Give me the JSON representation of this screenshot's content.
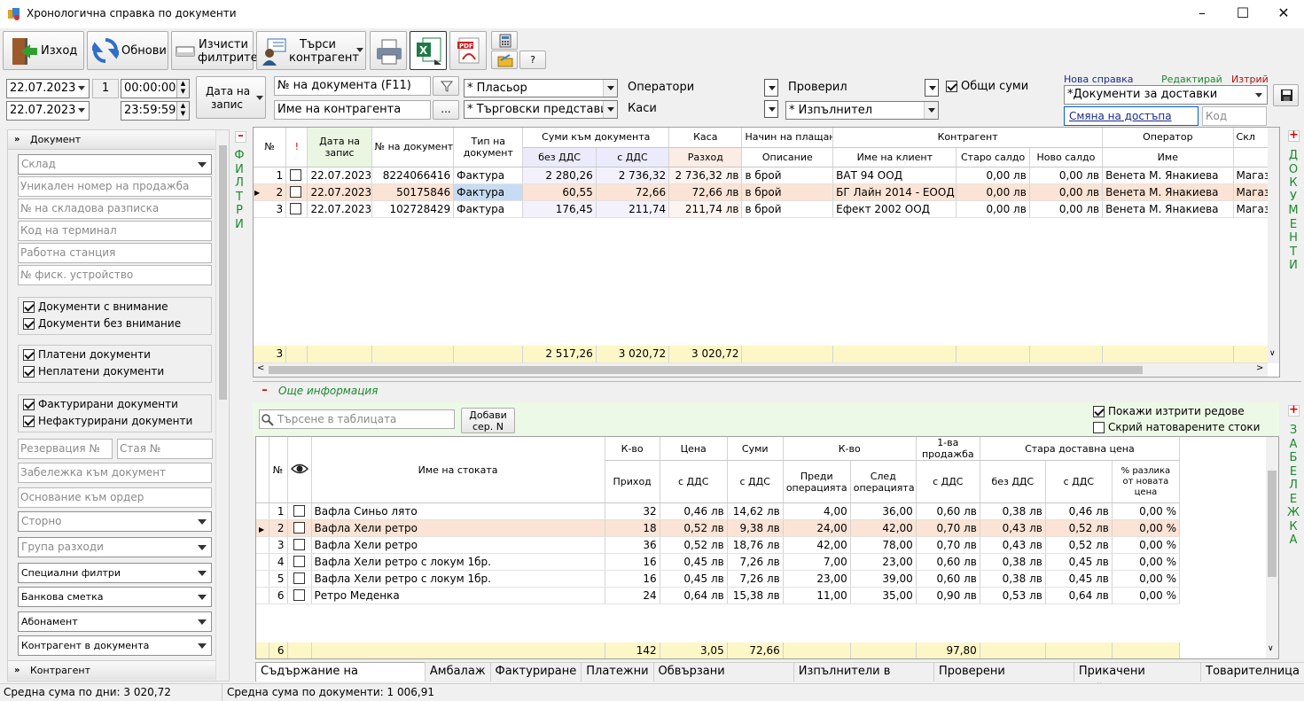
{
  "window": {
    "title": "Хронологична справка по документи"
  },
  "toolbar": {
    "exit": "Изход",
    "refresh": "Обнови",
    "clear_line1": "Изчисти",
    "clear_line2": "филтрите",
    "search_line1": "Търси",
    "search_line2": "контрагент",
    "help": "?"
  },
  "filters": {
    "date_from": "22.07.2023",
    "date_to": "22.07.2023",
    "day_count": "1",
    "time_from": "00:00:00",
    "time_to": "23:59:59",
    "date_mode_line1": "Дата на",
    "date_mode_line2": "запис",
    "doc_number_placeholder": "№ на документа (F11)",
    "counterparty_placeholder": "Име на контрагента",
    "more_button": "...",
    "placer": "* Пласьор",
    "sales_reps": "* Търговски представител",
    "operators": "Оператори",
    "cashboxes": "Каси",
    "checked_by": "Проверил",
    "executor": "* Изпълнител",
    "totals_label": "Общи суми"
  },
  "report": {
    "new": "Нова справка",
    "edit": "Редактирай",
    "delete": "Изтрий",
    "selected": "*Документи за доставки",
    "change_access": "Смяна на достъпа",
    "code_placeholder": "Код"
  },
  "sidebar": {
    "section_document": "Документ",
    "warehouse": "Склад",
    "unique_sale_no": "Уникален номер на продажба",
    "warehouse_receipt_no": "№ на складова разписка",
    "terminal_code": "Код на терминал",
    "workstation": "Работна станция",
    "fiscal_device_no": "№ фиск. устройство",
    "chk_attention": "Документи с внимание",
    "chk_no_attention": "Документи без внимание",
    "chk_paid": "Платени документи",
    "chk_unpaid": "Неплатени документи",
    "chk_invoiced": "Фактурирани документи",
    "chk_not_invoiced": "Нефактурирани документи",
    "reservation_no": "Резервация №",
    "room_no": "Стая №",
    "doc_note": "Забележка към документ",
    "order_basis": "Основание към ордер",
    "storno": "Сторно",
    "expense_group": "Група разходи",
    "special_filters": "Специални филтри",
    "bank_account": "Банкова сметка",
    "subscription": "Абонамент",
    "doc_counterparty": "Контрагент в документа",
    "section_counterparty": "Контрагент",
    "filters_vertical": "ФИЛТРИ"
  },
  "docs": {
    "headers": {
      "no": "№",
      "attn": "!",
      "date_line1": "Дата на",
      "date_line2": "запис",
      "doc_no": "№ на документ",
      "type_line1": "Тип на",
      "type_line2": "документ",
      "sums": "Суми към документа",
      "no_vat": "без ДДС",
      "with_vat": "с ДДС",
      "cash": "Каса",
      "expense": "Разход",
      "payment": "Начин на плащане",
      "description": "Описание",
      "counterparty": "Контрагент",
      "client_name": "Име на клиент",
      "old_balance": "Старо салдо",
      "new_balance": "Ново салдо",
      "operator": "Оператор",
      "op_name": "Име",
      "store": "Скл"
    },
    "rows": [
      {
        "n": "1",
        "date": "22.07.2023",
        "doc": "8224066416",
        "type": "Фактура",
        "nov": "2 280,26",
        "wv": "2 736,32",
        "exp": "2 736,32 лв",
        "pay": "в брой",
        "client": "ВАТ 94 ООД",
        "old": "0,00 лв",
        "new": "0,00 лв",
        "op": "Венета М. Янакиева",
        "store": "Магазин Е"
      },
      {
        "n": "2",
        "date": "22.07.2023",
        "doc": "50175846",
        "type": "Фактура",
        "nov": "60,55",
        "wv": "72,66",
        "exp": "72,66 лв",
        "pay": "в брой",
        "client": "БГ Лайн 2014 - ЕООД",
        "old": "0,00 лв",
        "new": "0,00 лв",
        "op": "Венета М. Янакиева",
        "store": "Магазин Е"
      },
      {
        "n": "3",
        "date": "22.07.2023",
        "doc": "102728429",
        "type": "Фактура",
        "nov": "176,45",
        "wv": "211,74",
        "exp": "211,74 лв",
        "pay": "в брой",
        "client": "Ефект 2002 ООД",
        "old": "0,00 лв",
        "new": "0,00 лв",
        "op": "Венета М. Янакиева",
        "store": "Магазин Е"
      }
    ],
    "totals": {
      "count": "3",
      "nov": "2 517,26",
      "wv": "3 020,72",
      "exp": "3 020,72"
    },
    "documents_vertical": "ДОКУМЕНТИ"
  },
  "more": {
    "title": "Още информация",
    "search_placeholder": "Търсене в таблицата",
    "add_serial_line1": "Добави",
    "add_serial_line2": "сер. N",
    "show_deleted": "Покажи изтрити редове",
    "hide_loaded": "Скрий натоварените стоки",
    "note_vertical": "ЗАБЕЛЕЖКА"
  },
  "items": {
    "headers": {
      "no": "№",
      "name": "Име на стоката",
      "qty": "К-во",
      "income": "Приход",
      "price": "Цена",
      "with_vat": "с ДДС",
      "sums": "Суми",
      "sums_vat": "с ДДС",
      "qty2": "К-во",
      "before_line1": "Преди",
      "before_line2": "операцията",
      "after_line1": "След",
      "after_line2": "операцията",
      "first_sale_line1": "1-ва",
      "first_sale_line2": "продажба",
      "first_sale_vat": "с ДДС",
      "old_price": "Стара доставна цена",
      "op_no_vat": "без ДДС",
      "op_vat": "с ДДС",
      "diff_line1": "% разлика",
      "diff_line2": "от новата",
      "diff_line3": "цена"
    },
    "rows": [
      {
        "n": "1",
        "name": "Вафла Синьо лято",
        "qty": "32",
        "price": "0,46 лв",
        "sum": "14,62 лв",
        "before": "4,00",
        "after": "36,00",
        "first": "0,60 лв",
        "opn": "0,38 лв",
        "opv": "0,46 лв",
        "diff": "0,00 %"
      },
      {
        "n": "2",
        "name": "Вафла Хели ретро",
        "qty": "18",
        "price": "0,52 лв",
        "sum": "9,38 лв",
        "before": "24,00",
        "after": "42,00",
        "first": "0,70 лв",
        "opn": "0,43 лв",
        "opv": "0,52 лв",
        "diff": "0,00 %"
      },
      {
        "n": "3",
        "name": "Вафла Хели ретро",
        "qty": "36",
        "price": "0,52 лв",
        "sum": "18,76 лв",
        "before": "42,00",
        "after": "78,00",
        "first": "0,70 лв",
        "opn": "0,43 лв",
        "opv": "0,52 лв",
        "diff": "0,00 %"
      },
      {
        "n": "4",
        "name": "Вафла Хели ретро с локум 1бр.",
        "qty": "16",
        "price": "0,45 лв",
        "sum": "7,26 лв",
        "before": "7,00",
        "after": "23,00",
        "first": "0,60 лв",
        "opn": "0,38 лв",
        "opv": "0,45 лв",
        "diff": "0,00 %"
      },
      {
        "n": "5",
        "name": "Вафла Хели ретро с локум 1бр.",
        "qty": "16",
        "price": "0,45 лв",
        "sum": "7,26 лв",
        "before": "23,00",
        "after": "39,00",
        "first": "0,60 лв",
        "opn": "0,38 лв",
        "opv": "0,45 лв",
        "diff": "0,00 %"
      },
      {
        "n": "6",
        "name": "Ретро Меденка",
        "qty": "24",
        "price": "0,64 лв",
        "sum": "15,38 лв",
        "before": "11,00",
        "after": "35,00",
        "first": "0,90 лв",
        "opn": "0,53 лв",
        "opv": "0,64 лв",
        "diff": "0,00 %"
      }
    ],
    "totals": {
      "count": "6",
      "qty": "142",
      "price": "3,05",
      "sum": "72,66",
      "first": "97,80"
    }
  },
  "tabs": [
    "Съдържание на документа",
    "Амбалаж",
    "Фактуриране",
    "Платежни",
    "Обвързани документи",
    "Изпълнители в сервиз",
    "Проверени документи",
    "Прикачени файлове",
    "Товарителница"
  ],
  "status": {
    "avg_per_day": "Средна сума по дни: 3 020,72",
    "avg_per_doc": "Средна сума по документи: 1 006,91"
  }
}
